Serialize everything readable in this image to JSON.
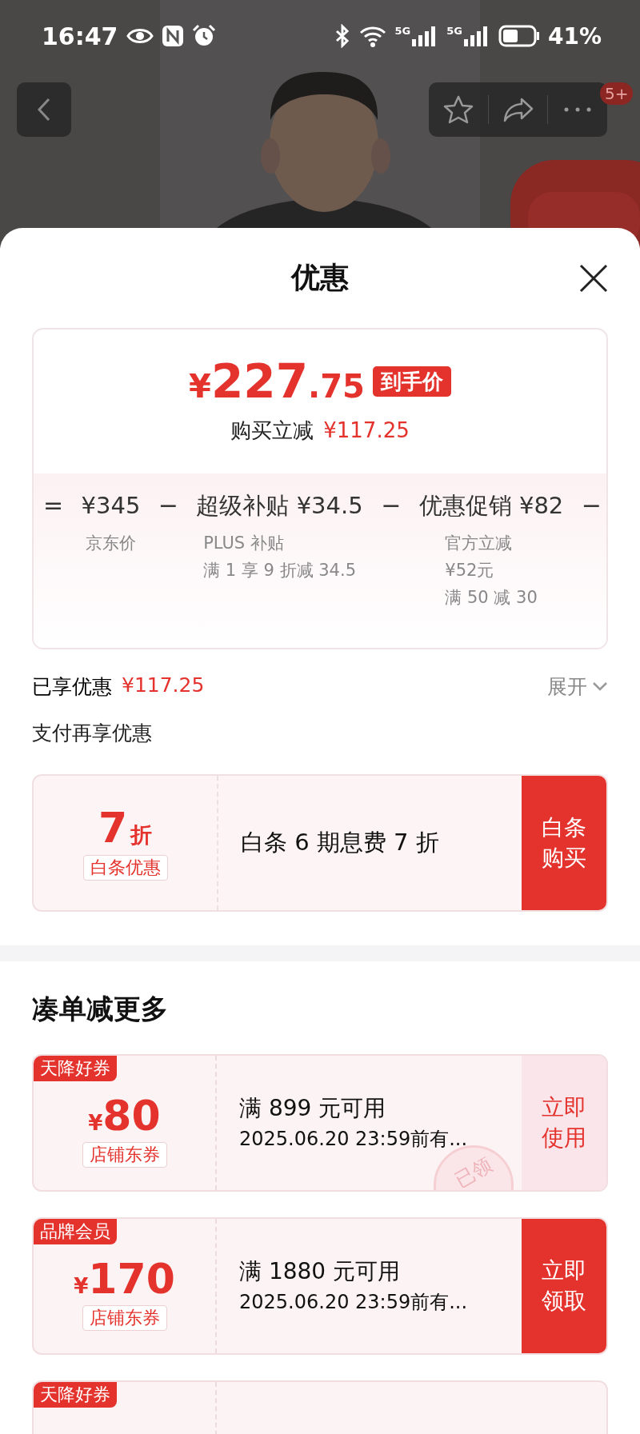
{
  "status_bar": {
    "time": "16:47",
    "network_labels": [
      "5G",
      "5G"
    ],
    "battery": "41%"
  },
  "header_actions": {
    "badge": "5+"
  },
  "sheet": {
    "title": "优惠"
  },
  "price_summary": {
    "currency": "¥",
    "price_integer": "227",
    "price_decimal": ".75",
    "price_tag": "到手价",
    "reduction_label": "购买立减",
    "reduction_amount": "¥117.25",
    "breakdown": [
      {
        "operator": "=",
        "amount": "¥345",
        "notes": [
          "京东价"
        ]
      },
      {
        "operator": "−",
        "amount": "超级补贴 ¥34.5",
        "notes": [
          "PLUS 补贴",
          "满 1 享 9 折减 34.5"
        ]
      },
      {
        "operator": "−",
        "amount": "优惠促销 ¥82",
        "notes": [
          "官方立减",
          "¥52元",
          "满 50 减 30"
        ]
      }
    ],
    "trailing_operator": "−"
  },
  "saved": {
    "label": "已享优惠",
    "amount": "¥117.25",
    "toggle": "展开",
    "expanded": false
  },
  "payment": {
    "title": "支付再享优惠",
    "offer": {
      "discount": "7",
      "discount_unit": "折",
      "tag": "白条优惠",
      "description": "白条 6 期息费 7 折",
      "button": "白条购买"
    }
  },
  "more_deals": {
    "title": "凑单减更多",
    "coupons": [
      {
        "tag": "天降好券",
        "currency": "¥",
        "amount": "80",
        "type": "店铺东券",
        "condition": "满 899 元可用",
        "validity": "2025.06.20 23:59前有...",
        "action": "立即使用",
        "claimed": true,
        "stamp": "已领"
      },
      {
        "tag": "品牌会员",
        "currency": "¥",
        "amount": "170",
        "type": "店铺东券",
        "condition": "满 1880 元可用",
        "validity": "2025.06.20 23:59前有...",
        "action": "立即领取",
        "claimed": false
      },
      {
        "tag": "天降好券"
      }
    ]
  }
}
